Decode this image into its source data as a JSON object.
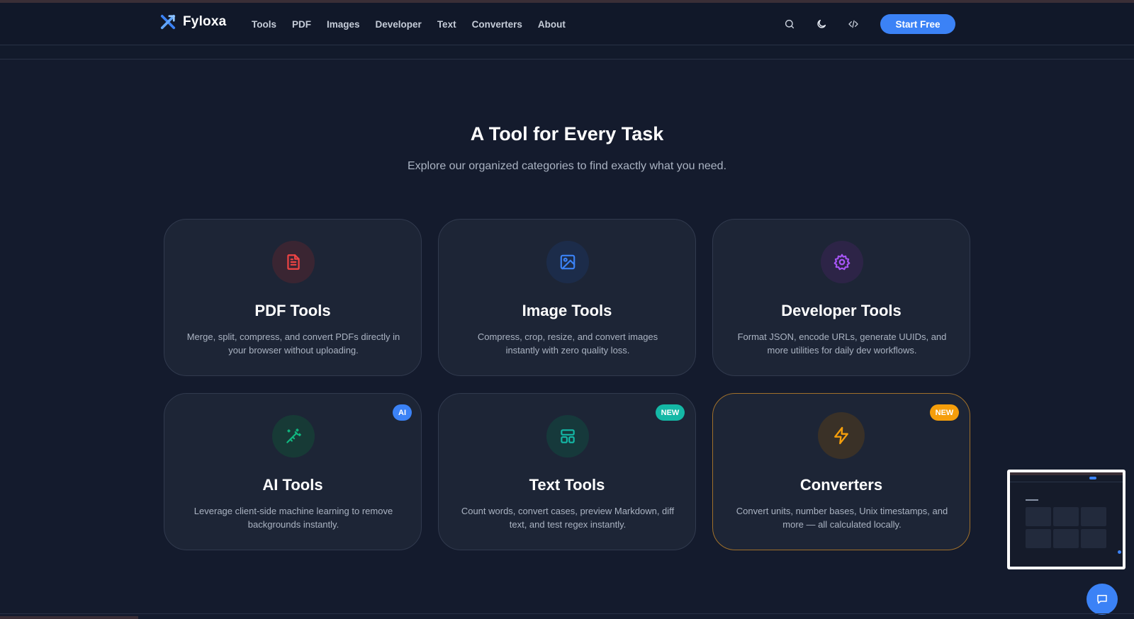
{
  "brand": {
    "name": "Fyloxa",
    "logo_icon": "arrows-cross-icon",
    "accent": "#3b82f6"
  },
  "nav": {
    "links": [
      "Tools",
      "PDF",
      "Images",
      "Developer",
      "Text",
      "Converters",
      "About"
    ],
    "icons": [
      "search-icon",
      "moon-icon",
      "code-icon"
    ],
    "cta": "Start Free"
  },
  "section": {
    "title": "A Tool for Every Task",
    "subtitle": "Explore our organized categories to find exactly what you need."
  },
  "cards": [
    {
      "title": "PDF Tools",
      "desc": "Merge, split, compress, and convert PDFs directly in your browser without uploading.",
      "icon": "file-text-icon",
      "color": "#ef4444",
      "badge": ""
    },
    {
      "title": "Image Tools",
      "desc": "Compress, crop, resize, and convert images instantly with zero quality loss.",
      "icon": "image-icon",
      "color": "#3b82f6",
      "badge": ""
    },
    {
      "title": "Developer Tools",
      "desc": "Format JSON, encode URLs, generate UUIDs, and more utilities for daily dev workflows.",
      "icon": "gear-icon",
      "color": "#a855f7",
      "badge": ""
    },
    {
      "title": "AI Tools",
      "desc": "Leverage client-side machine learning to remove backgrounds instantly.",
      "icon": "magic-wand-icon",
      "color": "#10b981",
      "badge": "AI",
      "badge_color": "#3b82f6"
    },
    {
      "title": "Text Tools",
      "desc": "Count words, convert cases, preview Markdown, diff text, and test regex instantly.",
      "icon": "layout-icon",
      "color": "#14b8a6",
      "badge": "NEW",
      "badge_color": "#14b8a6"
    },
    {
      "title": "Converters",
      "desc": "Convert units, number bases, Unix timestamps, and more — all calculated locally.",
      "icon": "lightning-icon",
      "color": "#f59e0b",
      "badge": "NEW",
      "badge_color": "#f59e0b"
    }
  ],
  "chat": {
    "icon": "chat-bubble-icon"
  }
}
